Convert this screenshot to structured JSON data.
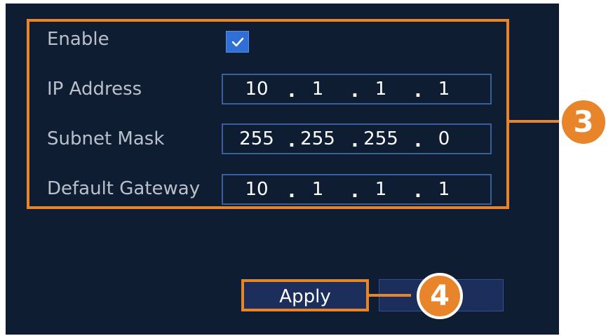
{
  "colors": {
    "panel_background": "#0f1d33",
    "highlight": "#e8852a",
    "field_border": "#3a5f9a",
    "checkbox": "#2f6fd6",
    "button": "#1c2f5c",
    "label_text": "#b9c0cc"
  },
  "form": {
    "enable": {
      "label": "Enable",
      "checked": true,
      "icon": "checkmark-icon"
    },
    "ip_address": {
      "label": "IP Address",
      "octets": [
        "10",
        "1",
        "1",
        "1"
      ]
    },
    "subnet_mask": {
      "label": "Subnet Mask",
      "octets": [
        "255",
        "255",
        "255",
        "0"
      ]
    },
    "default_gateway": {
      "label": "Default Gateway",
      "octets": [
        "10",
        "1",
        "1",
        "1"
      ]
    },
    "separator": "."
  },
  "buttons": {
    "apply_label": "Apply",
    "second_label": ""
  },
  "annotations": {
    "step_3": "3",
    "step_4": "4"
  }
}
